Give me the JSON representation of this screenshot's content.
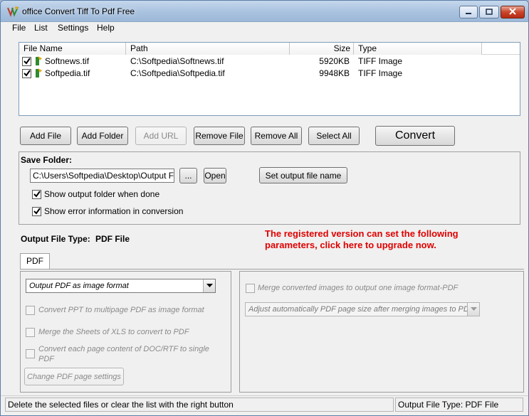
{
  "window": {
    "title": "office Convert Tiff To Pdf Free",
    "icons": {
      "app": "tiff-pdf-app-icon",
      "minimize": "minimize-icon",
      "maximize": "maximize-icon",
      "close": "close-icon"
    }
  },
  "menu": [
    "File",
    "List",
    "Settings",
    "Help"
  ],
  "file_list": {
    "columns": [
      "File Name",
      "Path",
      "Size",
      "Type"
    ],
    "rows": [
      {
        "checked": true,
        "name": "Softnews.tif",
        "path": "C:\\Softpedia\\Softnews.tif",
        "size": "5920KB",
        "type": "TIFF Image"
      },
      {
        "checked": true,
        "name": "Softpedia.tif",
        "path": "C:\\Softpedia\\Softpedia.tif",
        "size": "9948KB",
        "type": "TIFF Image"
      }
    ]
  },
  "toolbar": {
    "add_file": "Add File",
    "add_folder": "Add Folder",
    "add_url": "Add URL",
    "remove_file": "Remove File",
    "remove_all": "Remove All",
    "select_all": "Select All",
    "convert": "Convert"
  },
  "save_folder": {
    "label": "Save Folder:",
    "path": "C:\\Users\\Softpedia\\Desktop\\Output Files",
    "browse": "...",
    "open": "Open",
    "set_output_name": "Set output file name",
    "show_output_folder": {
      "label": "Show output folder when done",
      "checked": true
    },
    "show_error_info": {
      "label": "Show error information in conversion",
      "checked": true
    }
  },
  "output_type": {
    "label": "Output File Type:",
    "value": "PDF File",
    "upgrade_notice_line1": "The registered version can set the following",
    "upgrade_notice_line2": "parameters, click here to upgrade now."
  },
  "pdf_tab": {
    "label": "PDF",
    "format_select": "Output PDF as image format",
    "opt_ppt": "Convert PPT to multipage PDF as image format",
    "opt_xls": "Merge the Sheets of XLS to convert to PDF",
    "opt_doc_line1": "Convert each page content of DOC/RTF to single",
    "opt_doc_line2": "PDF",
    "page_settings": "Change PDF page settings",
    "merge_images": "Merge converted images to output one image format-PDF",
    "page_size_select": "Adjust automatically PDF page size after merging images to PDF"
  },
  "status": {
    "hint": "Delete the selected files or clear the list with the right button",
    "type_label": "Output File Type:  PDF File"
  }
}
